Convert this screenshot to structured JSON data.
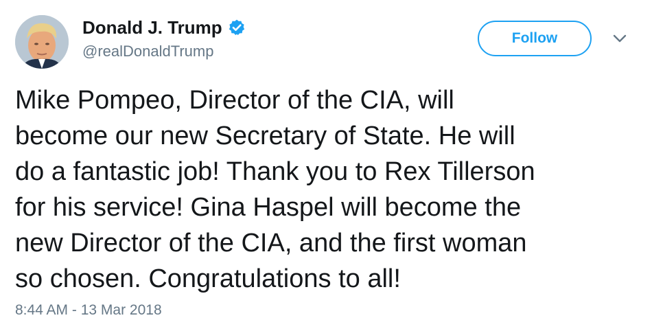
{
  "colors": {
    "accent": "#1da1f2",
    "text_primary": "#14171a",
    "text_secondary": "#657786",
    "background": "#ffffff"
  },
  "author": {
    "display_name": "Donald J. Trump",
    "handle": "@realDonaldTrump",
    "verified": true,
    "verified_icon": "verified-badge-icon",
    "avatar_icon": "avatar"
  },
  "actions": {
    "follow_label": "Follow",
    "menu_icon": "chevron-down-icon"
  },
  "tweet": {
    "lines": [
      "Mike Pompeo, Director of the CIA, will",
      "become our new Secretary of State. He will",
      "do a fantastic job! Thank you to Rex Tillerson",
      "for his service! Gina Haspel will become the",
      "new Director of the CIA, and the first woman",
      "so chosen. Congratulations to all!"
    ],
    "timestamp": "8:44 AM - 13 Mar 2018"
  }
}
